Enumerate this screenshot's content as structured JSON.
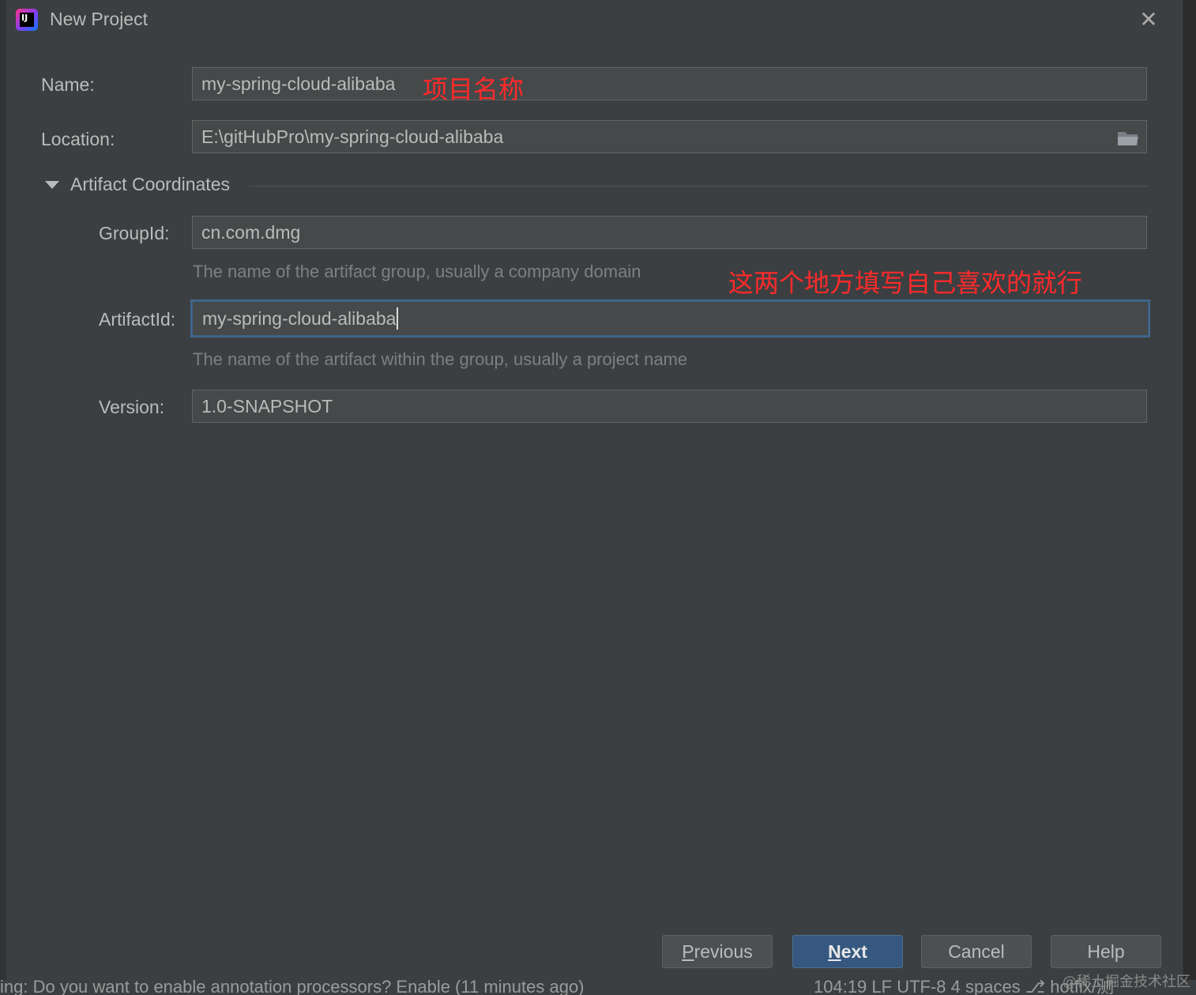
{
  "window": {
    "title": "New Project",
    "close_glyph": "✕"
  },
  "form": {
    "name": {
      "label": "Name:",
      "value": "my-spring-cloud-alibaba",
      "annotation": "项目名称"
    },
    "location": {
      "label": "Location:",
      "value": "E:\\gitHubPro\\my-spring-cloud-alibaba",
      "icon": "folder-icon"
    },
    "artifact_section": {
      "label": "Artifact Coordinates",
      "expanded": true
    },
    "group_id": {
      "label": "GroupId:",
      "value": "cn.com.dmg",
      "hint": "The name of the artifact group, usually a company domain"
    },
    "artifact_id": {
      "label": "ArtifactId:",
      "value": "my-spring-cloud-alibaba",
      "hint": "The name of the artifact within the group, usually a project name",
      "focused": true
    },
    "version": {
      "label": "Version:",
      "value": "1.0-SNAPSHOT"
    },
    "annotation_fields": "这两个地方填写自己喜欢的就行"
  },
  "buttons": {
    "previous": {
      "first": "P",
      "rest": "revious"
    },
    "next": {
      "first": "N",
      "rest": "ext"
    },
    "cancel": "Cancel",
    "help": "Help"
  },
  "statusbar": {
    "message": "ing: Do you want to enable annotation processors? Enable (11 minutes ago)",
    "right": "104:19   LF   UTF-8   4 spaces   ⎇ hotfix/测"
  },
  "watermark": "@稀土掘金技术社区",
  "colors": {
    "dialog_bg": "#3c3f41",
    "field_bg": "#45494a",
    "annotation": "#ff2a2a",
    "primary_button": "#365880",
    "focus_border": "#3d6185"
  }
}
